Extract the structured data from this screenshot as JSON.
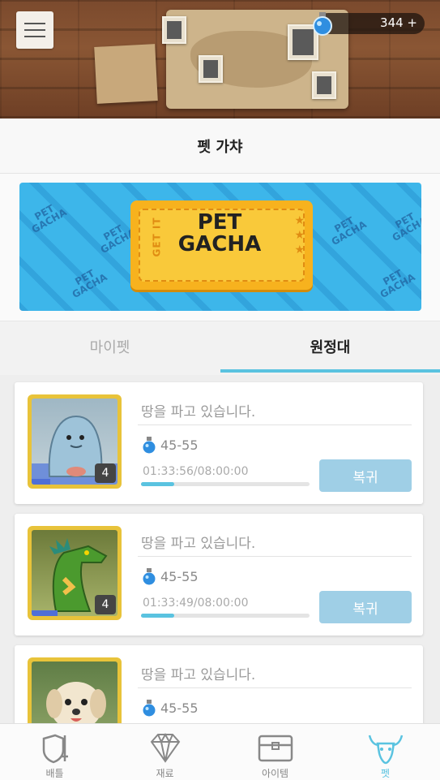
{
  "header": {
    "currency_count": "344 +"
  },
  "title": "펫 가챠",
  "banner": {
    "ticket_title_line1": "PET",
    "ticket_title_line2": "GACHA",
    "ticket_side": "GET IT",
    "pattern_line1": "PET",
    "pattern_line2": "GACHA"
  },
  "tabs": [
    {
      "label": "마이펫",
      "active": false
    },
    {
      "label": "원정대",
      "active": true
    }
  ],
  "expeditions": [
    {
      "status": "땅을 파고 있습니다.",
      "reward": "45-55",
      "timer": "01:33:56/08:00:00",
      "progress": 0.196,
      "level": "4",
      "pet_progress": 0.22,
      "recall_label": "복귀",
      "pet": "ghost"
    },
    {
      "status": "땅을 파고 있습니다.",
      "reward": "45-55",
      "timer": "01:33:49/08:00:00",
      "progress": 0.196,
      "level": "4",
      "pet_progress": 0.3,
      "recall_label": "복귀",
      "pet": "dragon"
    },
    {
      "status": "땅을 파고 있습니다.",
      "reward": "45-55",
      "pet": "dog"
    }
  ],
  "nav": [
    {
      "label": "배틀",
      "icon": "shield-sword-icon",
      "active": false
    },
    {
      "label": "재료",
      "icon": "diamond-icon",
      "active": false
    },
    {
      "label": "아이템",
      "icon": "treasure-chest-icon",
      "active": false
    },
    {
      "label": "펫",
      "icon": "bull-skull-icon",
      "active": true
    }
  ],
  "colors": {
    "accent": "#5ac3e0",
    "recall_button": "#9fcfe6",
    "frame_gold": "#e8c33a",
    "banner_blue": "#3db6ea",
    "ticket_yellow": "#f7b21e"
  }
}
